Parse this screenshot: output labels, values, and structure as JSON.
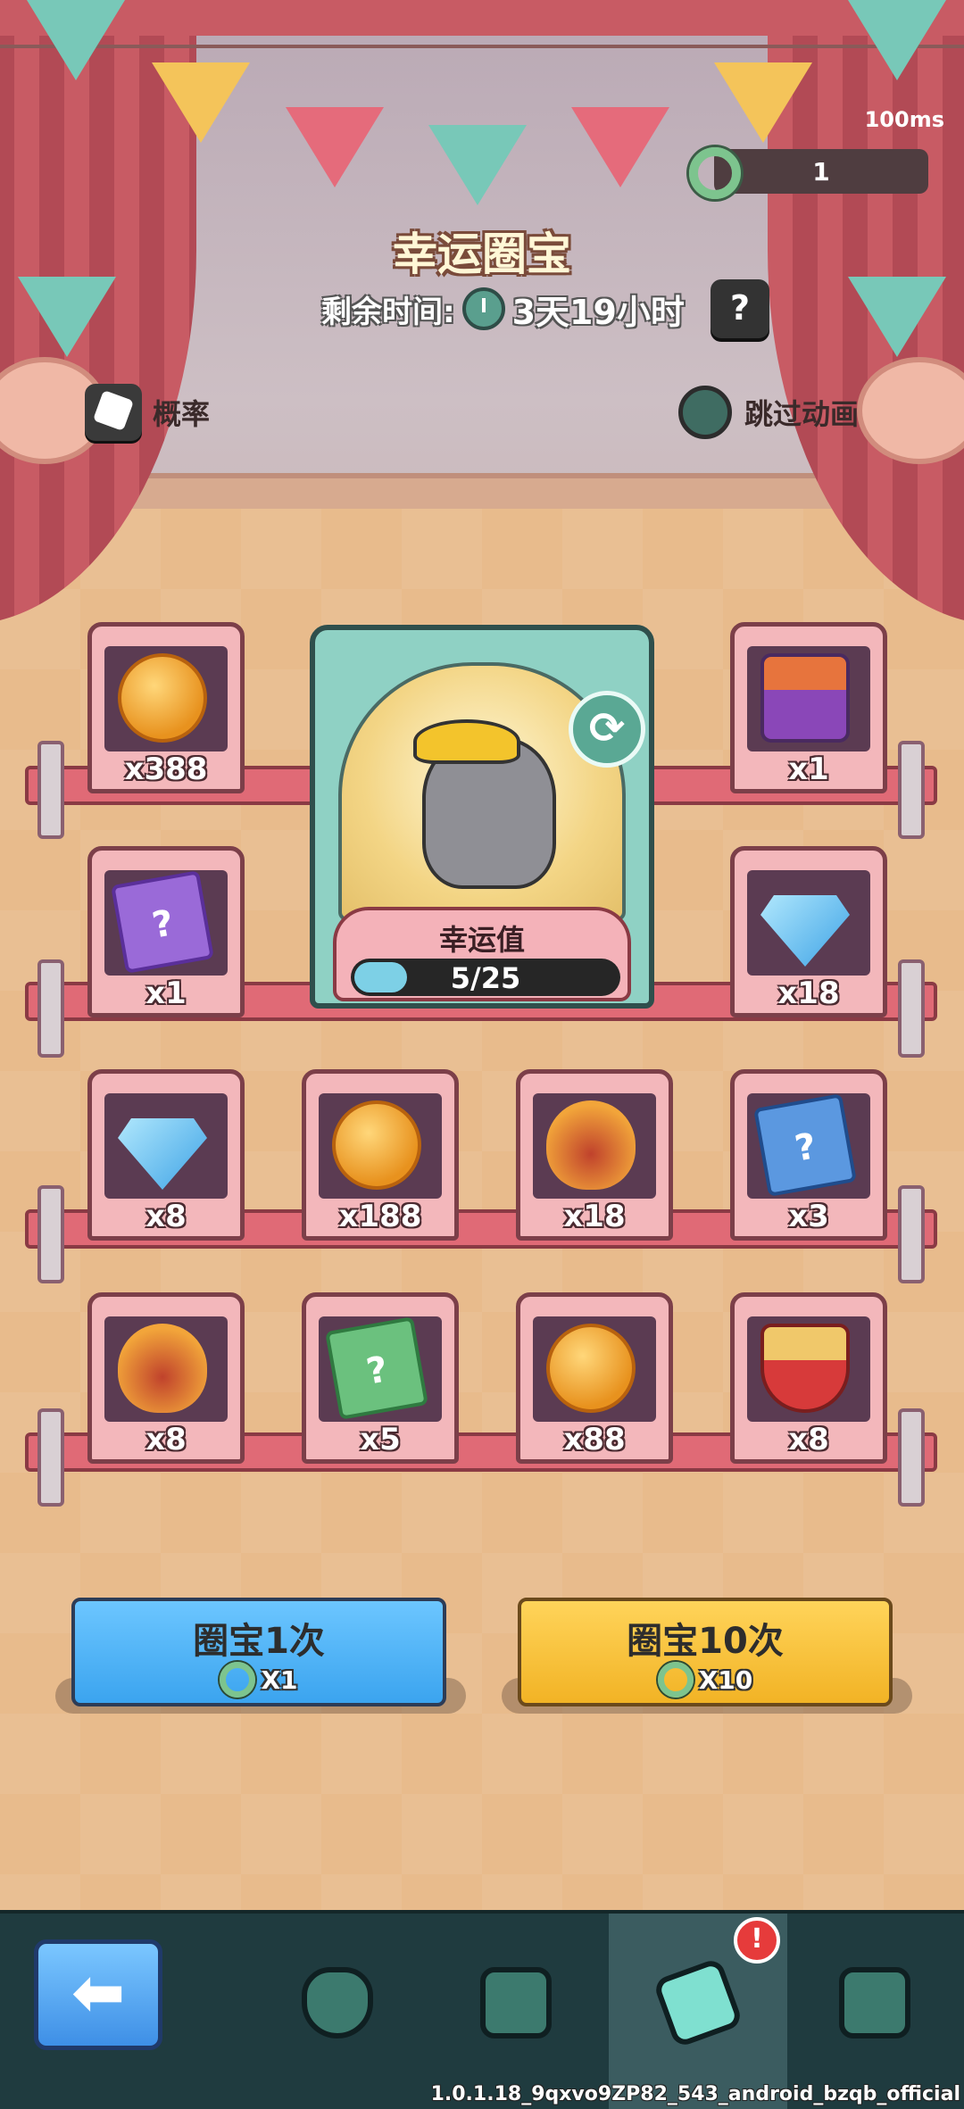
{
  "status": {
    "ping": "100ms"
  },
  "currency": {
    "value": "1",
    "icon": "green-ring-icon"
  },
  "header": {
    "title": "幸运圈宝",
    "time_label": "剩余时间:",
    "time_value": "3天19小时",
    "help_label": "?"
  },
  "controls": {
    "probability_label": "概率",
    "skip_animation_label": "跳过动画",
    "skip_animation_on": false
  },
  "featured": {
    "luck_label": "幸运值",
    "luck_current": 5,
    "luck_max": 25,
    "luck_text": "5/25",
    "refresh_icon": "refresh-icon"
  },
  "prizes": {
    "row1": [
      {
        "icon": "paw-coin-icon",
        "count": "x388"
      },
      {
        "icon": "cat-food-can-icon",
        "count": "x1"
      }
    ],
    "row2": [
      {
        "icon": "purple-mystery-cards-icon",
        "count": "x1"
      },
      {
        "icon": "diamond-icon",
        "count": "x18"
      }
    ],
    "row3": [
      {
        "icon": "diamond-icon",
        "count": "x8"
      },
      {
        "icon": "paw-coin-icon",
        "count": "x188"
      },
      {
        "icon": "flame-cat-icon",
        "count": "x18"
      },
      {
        "icon": "blue-mystery-cards-icon",
        "count": "x3"
      }
    ],
    "row4": [
      {
        "icon": "flame-cat-icon",
        "count": "x8"
      },
      {
        "icon": "green-mystery-cards-icon",
        "count": "x5"
      },
      {
        "icon": "paw-coin-icon",
        "count": "x88"
      },
      {
        "icon": "food-bowl-icon",
        "count": "x8"
      }
    ]
  },
  "actions": {
    "draw_once": {
      "label": "圈宝1次",
      "cost": "X1"
    },
    "draw_ten": {
      "label": "圈宝10次",
      "cost": "X10"
    }
  },
  "nav": {
    "items": [
      "back-arrow-icon",
      "paw-shield-icon",
      "calendar-icon",
      "party-popper-icon",
      "gift-icon"
    ],
    "active_index": 3,
    "alert": "!"
  },
  "footer": {
    "version": "1.0.1.18_9qxvo9ZP82_543_android_bzqb_official"
  },
  "colors": {
    "accent_blue": "#3ba4ef",
    "accent_yellow": "#f2b325",
    "nav_bg": "#1f3b3f",
    "shelf_pink": "#e06a76"
  }
}
